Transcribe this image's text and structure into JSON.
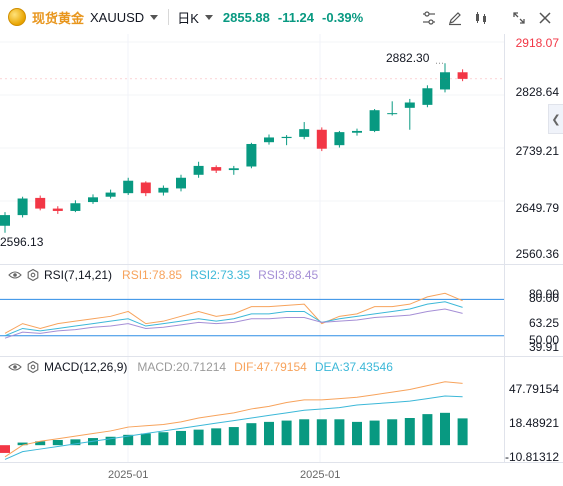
{
  "header": {
    "symbol_name": "现货黄金",
    "symbol_code": "XAUUSD",
    "period": "日K",
    "last_price": "2855.88",
    "change": "-11.24",
    "change_pct": "-0.39%"
  },
  "toolbar_icons": [
    "chart-settings-icon",
    "draw-icon",
    "indicator-icon",
    "fullscreen-icon",
    "close-icon"
  ],
  "colors": {
    "up": "#089981",
    "down": "#f23645",
    "rsi1": "#f7a35c",
    "rsi2": "#3cb8d8",
    "rsi3": "#a58fd6",
    "macd": "#9a9a9a",
    "dif": "#f7a35c",
    "dea": "#3cb8d8",
    "guide": "#2e8de6"
  },
  "price_axis": {
    "labels": [
      "2918.07",
      "2828.64",
      "2739.21",
      "2649.79",
      "2560.36"
    ],
    "high_marker": "2882.30",
    "low_marker": "2596.13"
  },
  "rsi": {
    "name": "RSI(7,14,21)",
    "rsi1": "RSI1:78.85",
    "rsi2": "RSI2:73.35",
    "rsi3": "RSI3:68.45",
    "axis_labels": [
      "80.00",
      "63.25",
      "50.00",
      "39.91"
    ],
    "axis_label_overlap": "80.00",
    "axis_label_hidden": "50.00"
  },
  "macd": {
    "name": "MACD(12,26,9)",
    "macd": "MACD:20.71214",
    "dif": "DIF:47.79154",
    "dea": "DEA:37.43546",
    "axis_labels": [
      "47.79154",
      "18.48921",
      "-10.81312"
    ]
  },
  "time_axis": {
    "labels": [
      "2025-01",
      "2025-01"
    ]
  },
  "chart_data": {
    "type": "candlestick",
    "period": "daily",
    "price_range": [
      2560.36,
      2918.07
    ],
    "candles": [
      {
        "o": 2608,
        "c": 2626,
        "h": 2631,
        "l": 2596.13
      },
      {
        "o": 2626,
        "c": 2654,
        "h": 2657,
        "l": 2622
      },
      {
        "o": 2655,
        "c": 2637,
        "h": 2659,
        "l": 2634
      },
      {
        "o": 2637,
        "c": 2633,
        "h": 2641,
        "l": 2628
      },
      {
        "o": 2633,
        "c": 2646,
        "h": 2651,
        "l": 2631
      },
      {
        "o": 2648,
        "c": 2656,
        "h": 2661,
        "l": 2645
      },
      {
        "o": 2657,
        "c": 2664,
        "h": 2669,
        "l": 2654
      },
      {
        "o": 2663,
        "c": 2684,
        "h": 2689,
        "l": 2660
      },
      {
        "o": 2681,
        "c": 2663,
        "h": 2683,
        "l": 2658
      },
      {
        "o": 2664,
        "c": 2672,
        "h": 2676,
        "l": 2659
      },
      {
        "o": 2671,
        "c": 2689,
        "h": 2694,
        "l": 2666
      },
      {
        "o": 2694,
        "c": 2709,
        "h": 2716,
        "l": 2689
      },
      {
        "o": 2707,
        "c": 2701,
        "h": 2710,
        "l": 2697
      },
      {
        "o": 2702,
        "c": 2705,
        "h": 2709,
        "l": 2694
      },
      {
        "o": 2708,
        "c": 2746,
        "h": 2748,
        "l": 2705
      },
      {
        "o": 2749,
        "c": 2757,
        "h": 2762,
        "l": 2745
      },
      {
        "o": 2756,
        "c": 2758,
        "h": 2761,
        "l": 2744
      },
      {
        "o": 2758,
        "c": 2771,
        "h": 2783,
        "l": 2754
      },
      {
        "o": 2770,
        "c": 2738,
        "h": 2774,
        "l": 2734
      },
      {
        "o": 2744,
        "c": 2766,
        "h": 2768,
        "l": 2740
      },
      {
        "o": 2765,
        "c": 2768,
        "h": 2772,
        "l": 2760
      },
      {
        "o": 2768,
        "c": 2803,
        "h": 2805,
        "l": 2766
      },
      {
        "o": 2797,
        "c": 2798,
        "h": 2818,
        "l": 2794
      },
      {
        "o": 2807,
        "c": 2816,
        "h": 2822,
        "l": 2770
      },
      {
        "o": 2812,
        "c": 2840,
        "h": 2845,
        "l": 2808
      },
      {
        "o": 2838,
        "c": 2867,
        "h": 2882.3,
        "l": 2833
      },
      {
        "o": 2867,
        "c": 2855.88,
        "h": 2872,
        "l": 2852
      }
    ],
    "rsi_range": [
      39.91,
      88.5
    ],
    "rsi_series": {
      "RSI1": [
        52,
        60,
        56,
        60,
        62,
        64,
        66,
        70,
        60,
        62,
        66,
        70,
        66,
        68,
        74,
        74,
        75,
        76,
        60,
        66,
        68,
        74,
        74,
        76,
        82,
        85,
        78.85
      ],
      "RSI2": [
        50,
        56,
        54,
        56,
        58,
        60,
        62,
        64,
        58,
        60,
        62,
        64,
        62,
        64,
        68,
        68,
        70,
        70,
        61,
        64,
        66,
        68,
        70,
        72,
        76,
        78,
        73.35
      ],
      "RSI3": [
        48,
        53,
        52,
        54,
        55,
        57,
        58,
        60,
        56,
        57,
        59,
        61,
        60,
        61,
        64,
        64,
        65,
        65,
        61,
        62,
        63,
        65,
        66,
        67,
        70,
        72,
        68.45
      ]
    },
    "rsi_levels": [
      80,
      50
    ],
    "macd_range": [
      -13,
      55
    ],
    "macd_series": {
      "MACD": [
        -6,
        2,
        3,
        4,
        4.5,
        5.5,
        6.5,
        8,
        9,
        10,
        11,
        12,
        13,
        14,
        17,
        18,
        19,
        20,
        20,
        20,
        18,
        19,
        20,
        21,
        24,
        25,
        20.71
      ],
      "DIF": [
        -9,
        0,
        3,
        5,
        7,
        9,
        11,
        14,
        15,
        16,
        18,
        21,
        23,
        25,
        28,
        30,
        33,
        35,
        35,
        36,
        37,
        39,
        41,
        43,
        46,
        49,
        47.79
      ],
      "DEA": [
        -11,
        -5,
        -3,
        -1,
        1,
        3,
        5,
        7,
        9,
        11,
        13,
        15,
        17,
        19,
        21,
        23,
        25,
        27,
        28,
        29,
        31,
        32,
        33,
        34,
        36,
        38,
        37.44
      ]
    }
  }
}
